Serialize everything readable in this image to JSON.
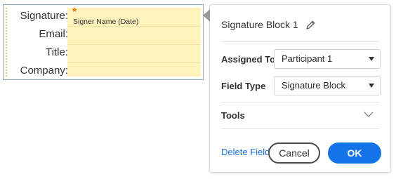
{
  "signature_block": {
    "labels": [
      "Signature:",
      "Email:",
      "Title:",
      "Company:"
    ],
    "required_marker": "*",
    "signer_hint": "Signer Name (Date)"
  },
  "popover": {
    "title": "Signature Block 1",
    "assigned_to": {
      "label": "Assigned To",
      "value": "Participant 1"
    },
    "field_type": {
      "label": "Field Type",
      "value": "Signature Block"
    },
    "tools_label": "Tools",
    "delete_label": "Delete Field",
    "cancel_label": "Cancel",
    "ok_label": "OK"
  },
  "colors": {
    "accent": "#1473e6",
    "field_fill": "#fff2bb",
    "required": "#e8731a"
  },
  "icons": [
    "pencil-icon",
    "caret-down-icon",
    "chevron-down-icon",
    "popover-pointer"
  ]
}
